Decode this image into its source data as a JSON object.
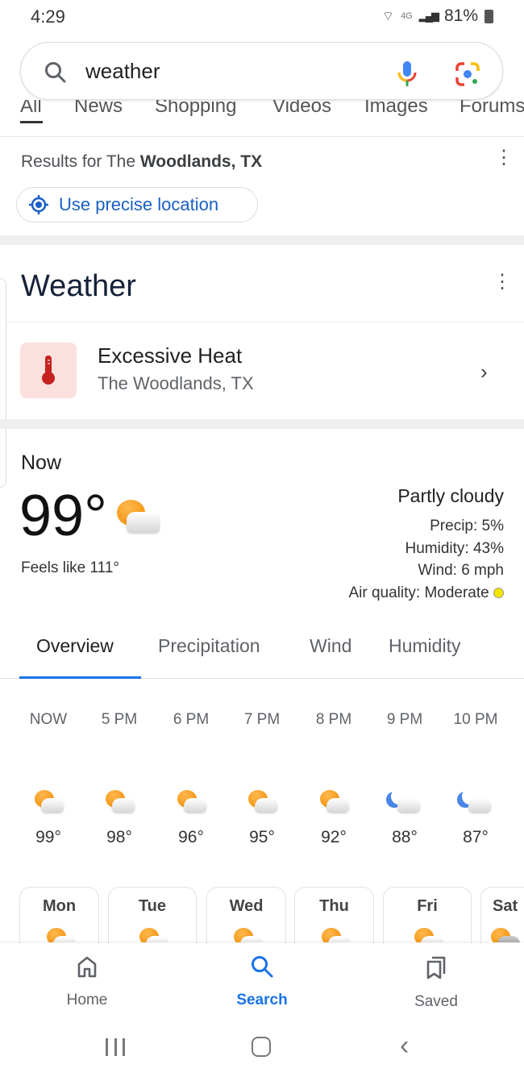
{
  "status": {
    "time": "4:29",
    "network": "4G",
    "battery": "81%"
  },
  "search": {
    "query": "weather"
  },
  "tabs": [
    "All",
    "News",
    "Shopping",
    "Videos",
    "Images",
    "Forums"
  ],
  "results": {
    "prefix": "Results for The ",
    "location": "Woodlands, TX",
    "precise_location": "Use precise location"
  },
  "weather": {
    "title": "Weather",
    "alert": {
      "title": "Excessive Heat",
      "location": "The Woodlands, TX"
    },
    "now_label": "Now",
    "temp": "99°",
    "feels_like": "Feels like 111°",
    "condition": "Partly cloudy",
    "precip": "Precip: 5%",
    "humidity": "Humidity: 43%",
    "wind": "Wind: 6 mph",
    "air_quality": "Air quality: Moderate",
    "air_quality_color": "#f5e400",
    "tabs": [
      "Overview",
      "Precipitation",
      "Wind",
      "Humidity"
    ],
    "hourly": [
      {
        "time": "NOW",
        "temp": "99°",
        "icon": "partly-cloudy"
      },
      {
        "time": "5 PM",
        "temp": "98°",
        "icon": "partly-cloudy"
      },
      {
        "time": "6 PM",
        "temp": "96°",
        "icon": "partly-cloudy"
      },
      {
        "time": "7 PM",
        "temp": "95°",
        "icon": "partly-cloudy"
      },
      {
        "time": "8 PM",
        "temp": "92°",
        "icon": "partly-cloudy"
      },
      {
        "time": "9 PM",
        "temp": "88°",
        "icon": "partly-cloudy-night"
      },
      {
        "time": "10 PM",
        "temp": "87°",
        "icon": "partly-cloudy-night"
      }
    ],
    "days": [
      {
        "day": "Mon",
        "icon": "partly-cloudy"
      },
      {
        "day": "Tue",
        "icon": "partly-cloudy"
      },
      {
        "day": "Wed",
        "icon": "partly-cloudy"
      },
      {
        "day": "Thu",
        "icon": "partly-cloudy"
      },
      {
        "day": "Fri",
        "icon": "partly-cloudy"
      },
      {
        "day": "Sat",
        "icon": "rain"
      }
    ]
  },
  "bottom_nav": [
    {
      "label": "Home",
      "icon": "home-icon"
    },
    {
      "label": "Search",
      "icon": "search-icon",
      "active": true
    },
    {
      "label": "Saved",
      "icon": "bookmarks-icon"
    }
  ],
  "colors": {
    "accent": "#1a73e8",
    "alert_red": "#c5221f"
  }
}
